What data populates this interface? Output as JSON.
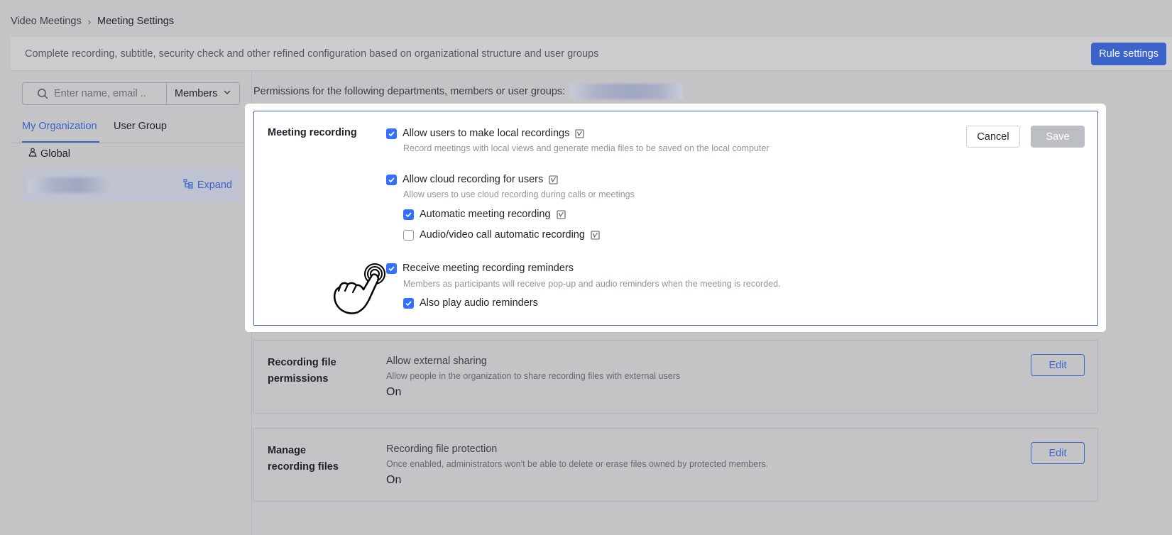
{
  "breadcrumb": {
    "items": [
      "Video Meetings",
      "Meeting Settings"
    ]
  },
  "banner": {
    "text": "Complete recording, subtitle, security check and other refined configuration based on organizational structure and user groups",
    "rule_button": "Rule settings"
  },
  "sidebar": {
    "search_placeholder": "Enter name, email ...",
    "filter_value": "Members",
    "tabs": [
      {
        "label": "My Organization",
        "active": true
      },
      {
        "label": "User Group",
        "active": false
      }
    ],
    "global_label": "Global",
    "expand_label": "Expand"
  },
  "main": {
    "permissions_label": "Permissions for the following departments, members or user groups:",
    "recording_card": {
      "title": "Meeting recording",
      "cancel_label": "Cancel",
      "save_label": "Save",
      "options": [
        {
          "label": "Allow users to make local recordings",
          "checked": true,
          "desc": "Record meetings with local views and generate media files to be saved on the local computer"
        },
        {
          "label": "Allow cloud recording for users",
          "checked": true,
          "desc": "Allow users to use cloud recording during calls or meetings"
        },
        {
          "label": "Automatic meeting recording",
          "checked": true
        },
        {
          "label": "Audio/video call automatic recording",
          "checked": false
        },
        {
          "label": "Receive meeting recording reminders",
          "checked": true,
          "desc": "Members as participants will receive pop-up and audio reminders when the meeting is recorded."
        },
        {
          "label": "Also play audio reminders",
          "checked": true
        }
      ]
    },
    "file_permissions": {
      "title": "Recording file permissions",
      "item": "Allow external sharing",
      "desc": "Allow people in the organization to share recording files with external users",
      "value": "On",
      "edit_label": "Edit"
    },
    "manage_files": {
      "title": "Manage recording files",
      "item": "Recording file protection",
      "desc": "Once enabled, administrators won't be able to delete or erase files owned by protected members.",
      "value": "On",
      "edit_label": "Edit"
    }
  },
  "colors": {
    "accent": "#3b63c9",
    "checkbox": "#3370ff",
    "overlay_background": "#c4c4c7"
  }
}
